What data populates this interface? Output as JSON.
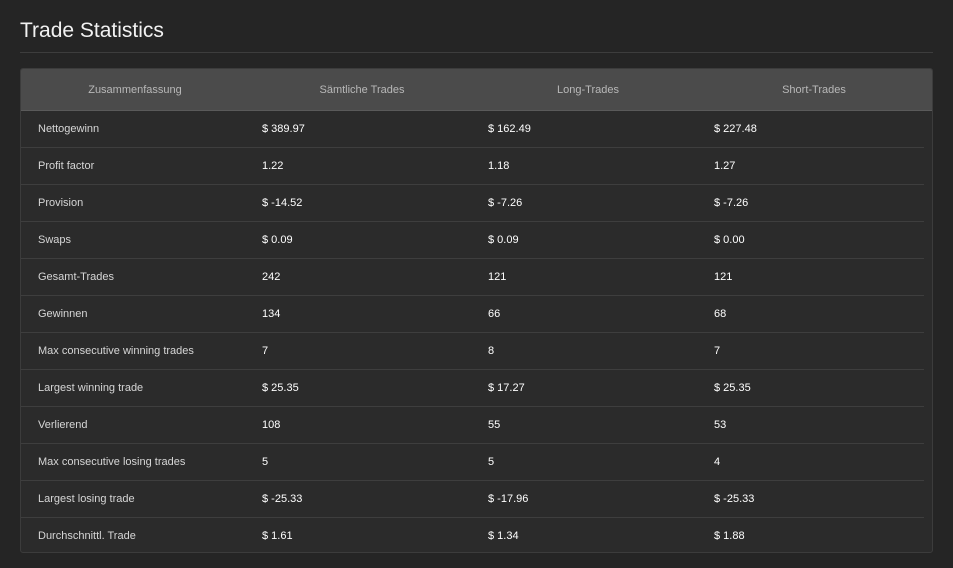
{
  "page": {
    "title": "Trade Statistics"
  },
  "table": {
    "headers": [
      "Zusammenfassung",
      "Sämtliche Trades",
      "Long-Trades",
      "Short-Trades"
    ],
    "rows": [
      {
        "label": "Nettogewinn",
        "all": "$ 389.97",
        "long": "$ 162.49",
        "short": "$ 227.48"
      },
      {
        "label": "Profit factor",
        "all": "1.22",
        "long": "1.18",
        "short": "1.27"
      },
      {
        "label": "Provision",
        "all": "$ -14.52",
        "long": "$ -7.26",
        "short": "$ -7.26"
      },
      {
        "label": "Swaps",
        "all": "$ 0.09",
        "long": "$ 0.09",
        "short": "$ 0.00"
      },
      {
        "label": "Gesamt-Trades",
        "all": "242",
        "long": "121",
        "short": "121"
      },
      {
        "label": "Gewinnen",
        "all": "134",
        "long": "66",
        "short": "68"
      },
      {
        "label": "Max consecutive winning trades",
        "all": "7",
        "long": "8",
        "short": "7"
      },
      {
        "label": "Largest winning trade",
        "all": "$ 25.35",
        "long": "$ 17.27",
        "short": "$ 25.35"
      },
      {
        "label": "Verlierend",
        "all": "108",
        "long": "55",
        "short": "53"
      },
      {
        "label": "Max consecutive losing trades",
        "all": "5",
        "long": "5",
        "short": "4"
      },
      {
        "label": "Largest losing trade",
        "all": "$ -25.33",
        "long": "$ -17.96",
        "short": "$ -25.33"
      },
      {
        "label": "Durchschnittl. Trade",
        "all": "$ 1.61",
        "long": "$ 1.34",
        "short": "$ 1.88"
      }
    ]
  }
}
